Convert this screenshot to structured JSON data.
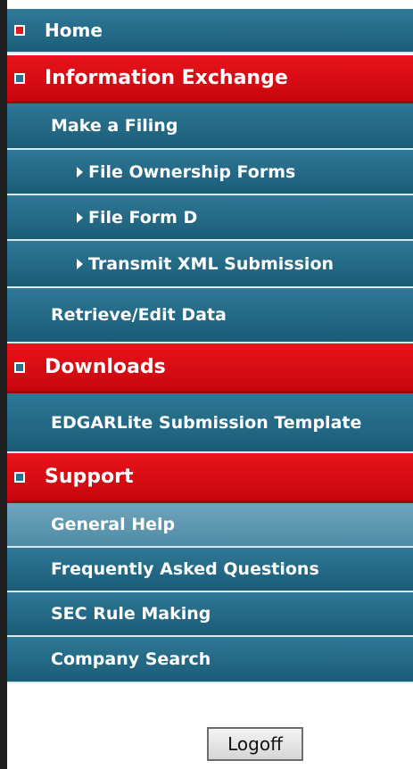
{
  "menu": {
    "home": {
      "label": "Home"
    },
    "information_exchange": {
      "label": "Information Exchange",
      "items": {
        "make_a_filing": "Make a Filing",
        "file_ownership_forms": "File Ownership Forms",
        "file_form_d": "File Form D",
        "transmit_xml_submission": "Transmit XML Submission",
        "retrieve_edit_data": "Retrieve/Edit Data"
      }
    },
    "downloads": {
      "label": "Downloads",
      "items": {
        "edgarlite_submission_template": "EDGARLite Submission Template"
      }
    },
    "support": {
      "label": "Support",
      "items": {
        "general_help": "General Help",
        "frequently_asked_questions": "Frequently Asked Questions",
        "sec_rule_making": "SEC Rule Making",
        "company_search": "Company Search"
      }
    }
  },
  "logoff_label": "Logoff",
  "colors": {
    "section_red": "#d40a12",
    "row_teal": "#256b89",
    "active_row": "#5f98b1"
  },
  "icons": {
    "section_marker": "square-bullet-icon",
    "sub_item_marker": "triangle-right-icon"
  }
}
